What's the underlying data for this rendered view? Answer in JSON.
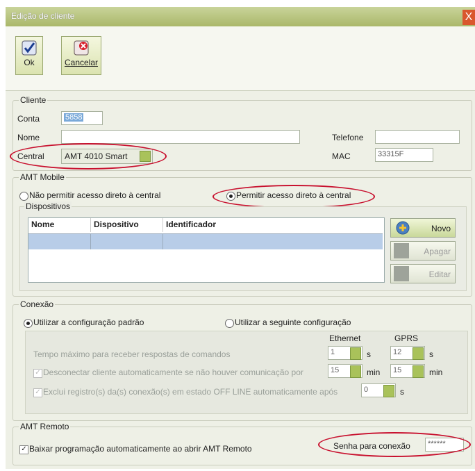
{
  "window": {
    "title": "Edição de cliente",
    "close": "X"
  },
  "toolbar": {
    "ok_label": "Ok",
    "cancel_label": "Cancelar"
  },
  "cliente": {
    "group_label": "Cliente",
    "conta_label": "Conta",
    "conta_value": "5858",
    "nome_label": "Nome",
    "nome_value": "",
    "central_label": "Central",
    "central_value": "AMT 4010 Smart",
    "telefone_label": "Telefone",
    "telefone_value": "",
    "mac_label": "MAC",
    "mac_value": "33315F"
  },
  "amt_mobile": {
    "group_label": "AMT Mobile",
    "option_deny": "Não permitir acesso direto à central",
    "option_allow": "Permitir acesso direto à central",
    "dispositivos_label": "Dispositivos",
    "columns": [
      "Nome",
      "Dispositivo",
      "Identificador"
    ],
    "btn_novo": "Novo",
    "btn_apagar": "Apagar",
    "btn_editar": "Editar"
  },
  "conexao": {
    "group_label": "Conexão",
    "option_default": "Utilizar a configuração padrão",
    "option_custom": "Utilizar a seguinte configuração",
    "col_ethernet": "Ethernet",
    "col_gprs": "GPRS",
    "row1_label": "Tempo máximo para receber respostas de comandos",
    "row1_eth": "1",
    "row1_eth_unit": "s",
    "row1_gprs": "12",
    "row1_gprs_unit": "s",
    "row2_label": "Desconectar cliente automaticamente se não houver comunicação por",
    "row2_eth": "15",
    "row2_eth_unit": "min",
    "row2_gprs": "15",
    "row2_gprs_unit": "min",
    "row3_label": "Exclui registro(s) da(s) conexão(s) em estado OFF LINE automaticamente após",
    "row3_value": "0",
    "row3_unit": "s"
  },
  "amt_remoto": {
    "group_label": "AMT Remoto",
    "auto_download_label": "Baixar programação automaticamente ao abrir AMT Remoto",
    "senha_label": "Senha para conexão",
    "senha_value": "******"
  },
  "colors": {
    "titlebar": "#aab86a",
    "accent_green": "#a9c25a",
    "highlight_red": "#c8102e",
    "selection": "#b8cde8"
  }
}
